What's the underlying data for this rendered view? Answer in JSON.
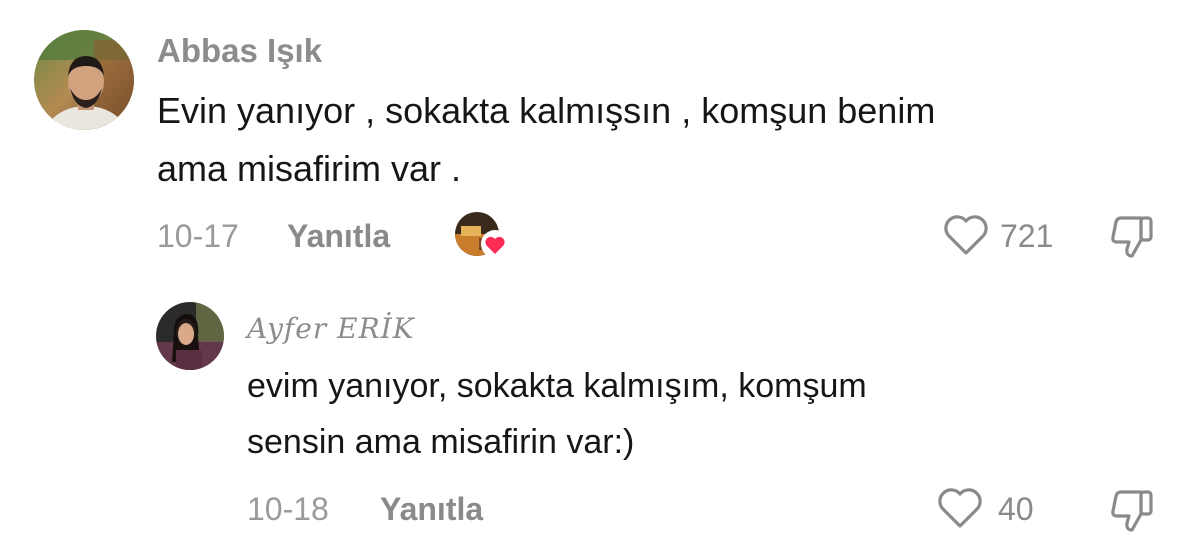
{
  "comments": [
    {
      "username": "Abbas Işık",
      "text_line1": "Evin yanıyor , sokakta kalmışsın , komşun benim",
      "text_line2": "ama misafirim var .",
      "date": "10-17",
      "reply_label": "Yanıtla",
      "like_count": "721",
      "creator_liked": true
    },
    {
      "username": "Ayfer ERİK",
      "text_line1": "evim yanıyor, sokakta kalmışım, komşum",
      "text_line2": "sensin ama misafirin var:)",
      "date": "10-18",
      "reply_label": "Yanıtla",
      "like_count": "40"
    }
  ],
  "icons": {
    "like": "heart-outline-icon",
    "dislike": "thumbs-down-outline-icon",
    "creator_like_badge": "red-heart-icon"
  },
  "colors": {
    "username": "#8c8c8c",
    "body_text": "#161616",
    "meta": "#8a8a8a",
    "creator_heart": "#fe2c55"
  }
}
